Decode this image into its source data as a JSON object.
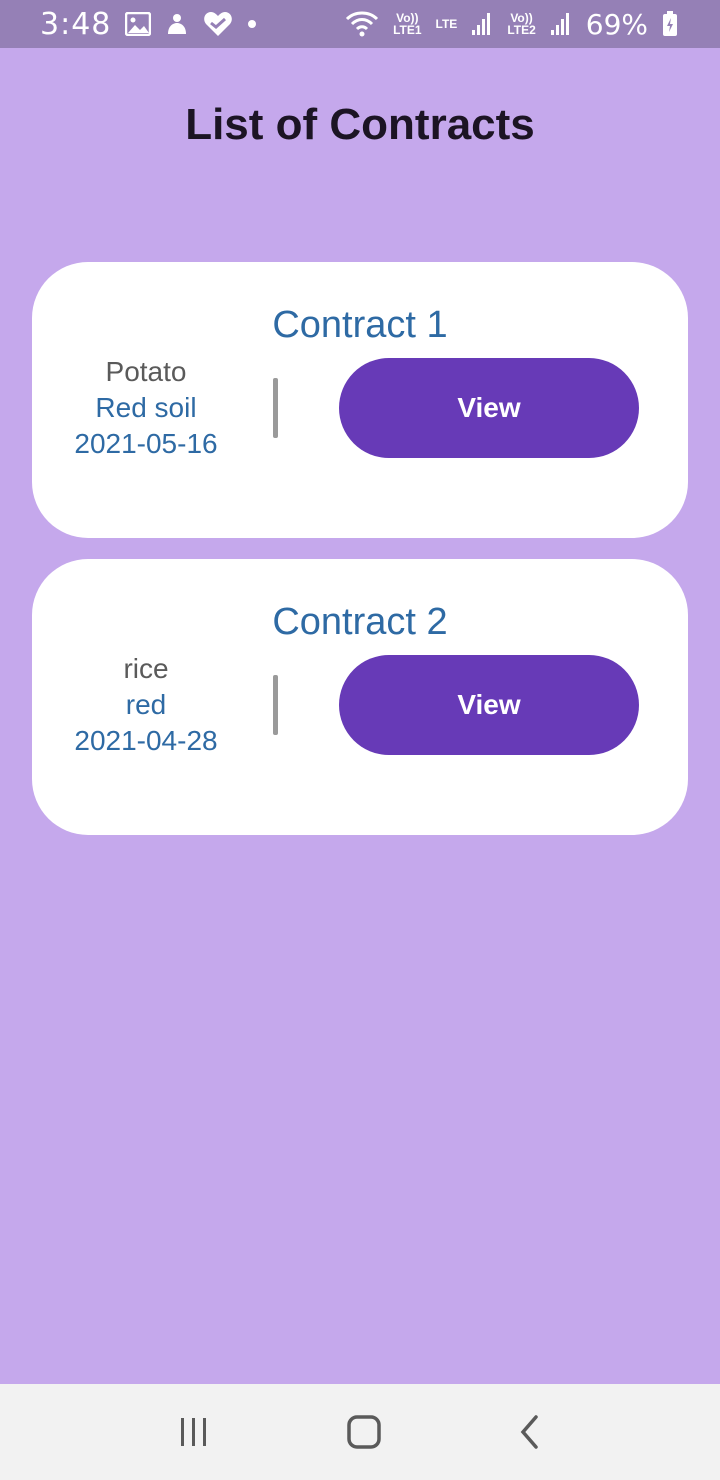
{
  "status_bar": {
    "time": "3:48",
    "battery": "69%",
    "sim1_top": "Vo))",
    "sim1_bottom": "LTE1",
    "lte_label": "LTE",
    "sim2_top": "Vo))",
    "sim2_bottom": "LTE2",
    "icons": [
      "gallery-icon",
      "app-icon",
      "health-icon",
      "dot-icon",
      "wifi-icon",
      "signal-icon",
      "battery-charging-icon"
    ]
  },
  "page": {
    "title": "List of Contracts"
  },
  "contracts": [
    {
      "title": "Contract 1",
      "crop": "Potato",
      "soil": "Red soil",
      "date": "2021-05-16",
      "button_label": "View"
    },
    {
      "title": "Contract 2",
      "crop": "rice",
      "soil": "red",
      "date": "2021-04-28",
      "button_label": "View"
    }
  ],
  "nav_bar": {
    "icons": [
      "recent-apps-icon",
      "home-icon",
      "back-icon"
    ]
  },
  "colors": {
    "background": "#c5a8ec",
    "status_bar": "#9580b6",
    "card": "#ffffff",
    "accent_button": "#673ab7",
    "title_blue": "#2e6aa4"
  }
}
